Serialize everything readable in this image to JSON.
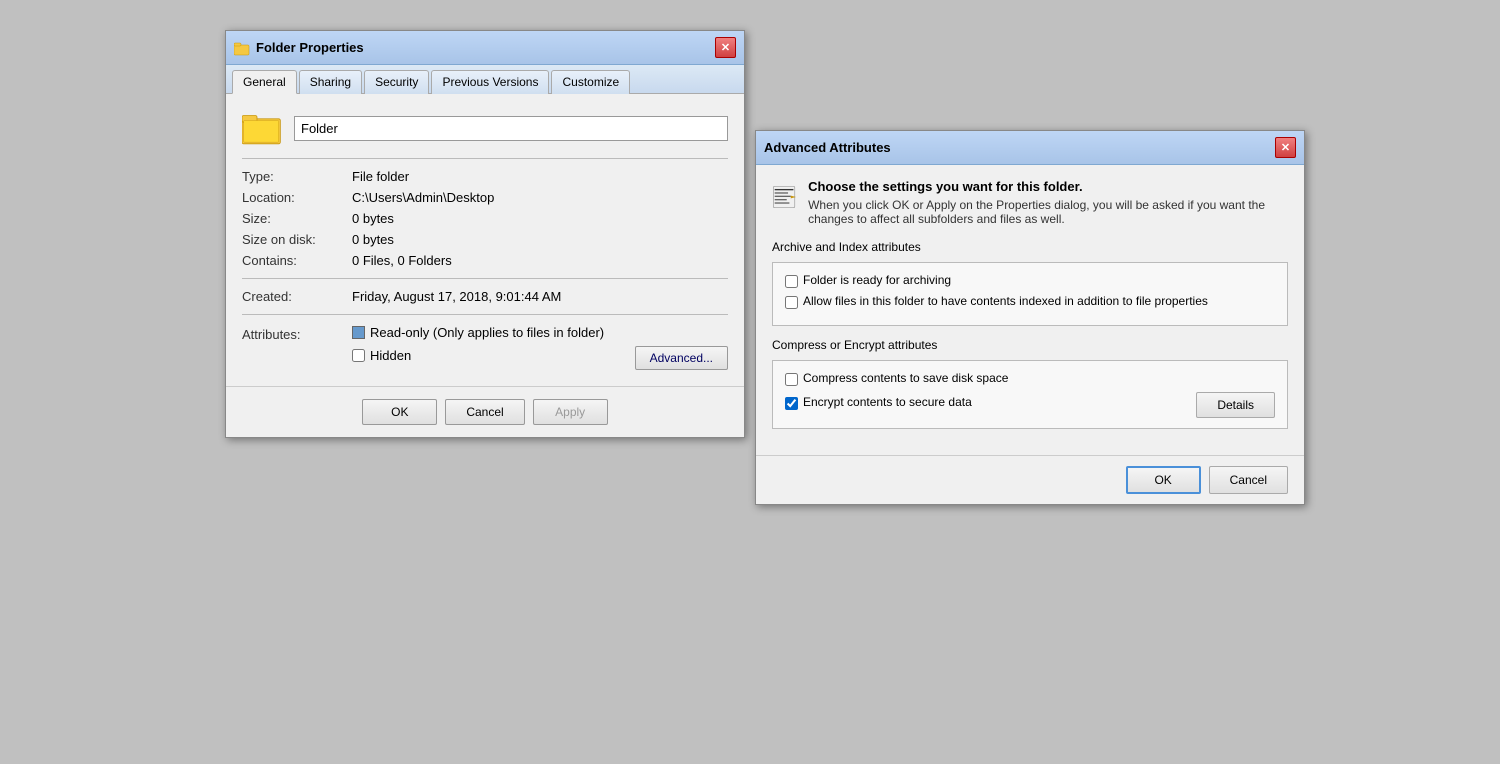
{
  "folderProps": {
    "title": "Folder Properties",
    "tabs": [
      {
        "id": "general",
        "label": "General",
        "active": true
      },
      {
        "id": "sharing",
        "label": "Sharing",
        "active": false
      },
      {
        "id": "security",
        "label": "Security",
        "active": false
      },
      {
        "id": "previous-versions",
        "label": "Previous Versions",
        "active": false
      },
      {
        "id": "customize",
        "label": "Customize",
        "active": false
      }
    ],
    "folderName": "Folder",
    "properties": {
      "type_label": "Type:",
      "type_value": "File folder",
      "location_label": "Location:",
      "location_value": "C:\\Users\\Admin\\Desktop",
      "size_label": "Size:",
      "size_value": "0 bytes",
      "size_on_disk_label": "Size on disk:",
      "size_on_disk_value": "0 bytes",
      "contains_label": "Contains:",
      "contains_value": "0 Files, 0 Folders",
      "created_label": "Created:",
      "created_value": "Friday, August 17, 2018, 9:01:44 AM",
      "attributes_label": "Attributes:"
    },
    "attributes": {
      "readonly_label": "Read-only (Only applies to files in folder)",
      "readonly_checked": true,
      "hidden_label": "Hidden",
      "hidden_checked": false,
      "advanced_btn": "Advanced..."
    },
    "buttons": {
      "ok": "OK",
      "cancel": "Cancel",
      "apply": "Apply"
    }
  },
  "advancedAttrs": {
    "title": "Advanced Attributes",
    "description_line1": "Choose the settings you want for this folder.",
    "description_line2": "When you click OK or Apply on the Properties dialog, you will be asked if you want the changes to affect all subfolders and files as well.",
    "archive_section_title": "Archive and Index attributes",
    "archive_checkbox": {
      "label": "Folder is ready for archiving",
      "checked": false
    },
    "index_checkbox": {
      "label": "Allow files in this folder to have contents indexed in addition to file properties",
      "checked": false
    },
    "compress_section_title": "Compress or Encrypt attributes",
    "compress_checkbox": {
      "label": "Compress contents to save disk space",
      "checked": false
    },
    "encrypt_checkbox": {
      "label": "Encrypt contents to secure data",
      "checked": true
    },
    "details_btn": "Details",
    "ok_btn": "OK",
    "cancel_btn": "Cancel"
  }
}
